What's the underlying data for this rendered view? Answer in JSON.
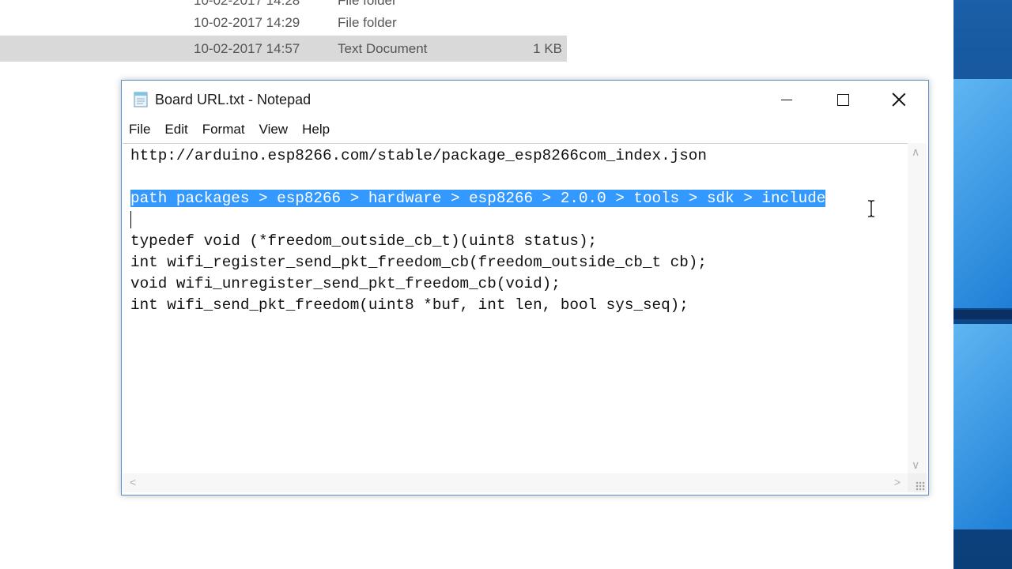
{
  "explorer": {
    "rows": [
      {
        "date": "10-02-2017 14:28",
        "type": "File folder",
        "size": ""
      },
      {
        "date": "10-02-2017 14:29",
        "type": "File folder",
        "size": ""
      },
      {
        "date": "10-02-2017 14:57",
        "type": "Text Document",
        "size": "1 KB"
      }
    ]
  },
  "notepad": {
    "title": "Board URL.txt - Notepad",
    "menu": [
      "File",
      "Edit",
      "Format",
      "View",
      "Help"
    ],
    "lines": [
      "http://arduino.esp8266.com/stable/package_esp8266com_index.json",
      "",
      "path packages > esp8266 > hardware > esp8266 > 2.0.0 > tools > sdk > include",
      "",
      "typedef void (*freedom_outside_cb_t)(uint8 status);",
      "int wifi_register_send_pkt_freedom_cb(freedom_outside_cb_t cb);",
      "void wifi_unregister_send_pkt_freedom_cb(void);",
      "int wifi_send_pkt_freedom(uint8 *buf, int len, bool sys_seq);"
    ],
    "selected_line_index": 2,
    "icons": {
      "app": "notepad-icon",
      "minimize": "minimize-icon",
      "maximize": "maximize-icon",
      "close": "close-icon",
      "cursor": "text-cursor-icon"
    },
    "colors": {
      "selection": "#3399ff",
      "border": "#5a8fc7"
    }
  }
}
